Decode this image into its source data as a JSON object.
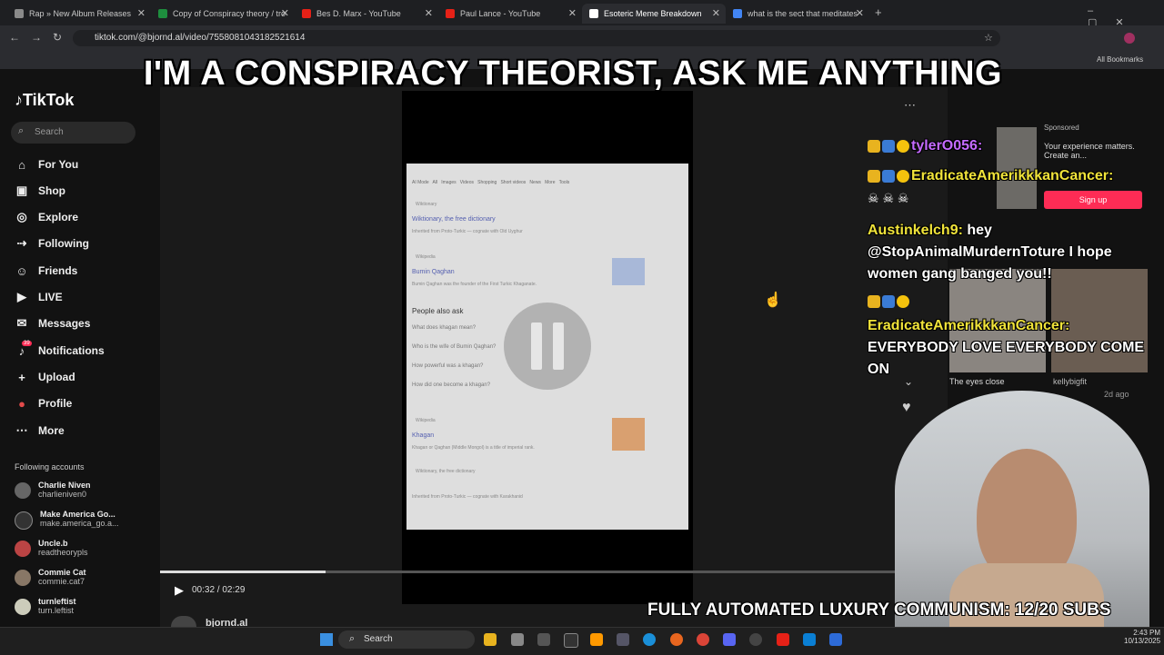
{
  "browser": {
    "tabs": [
      {
        "label": "Rap » New Album Releases",
        "color": "#8a8a8a"
      },
      {
        "label": "Copy of Conspiracy theory / tro",
        "color": "#1e8e3e"
      },
      {
        "label": "Bes D. Marx - YouTube",
        "color": "#e62117"
      },
      {
        "label": "Paul Lance - YouTube",
        "color": "#e62117"
      },
      {
        "label": "Esoteric Meme Breakdown",
        "color": "#ffffff"
      },
      {
        "label": "what is the sect that meditates",
        "color": "#4285f4"
      }
    ],
    "url": "tiktok.com/@bjornd.al/video/7558081043182521614",
    "all_bookmarks": "All Bookmarks"
  },
  "tiktok": {
    "logo": "TikTok",
    "search_placeholder": "Search",
    "nav": [
      {
        "label": "For You",
        "icon": "home-icon",
        "glyph": "⌂"
      },
      {
        "label": "Shop",
        "icon": "shop-icon",
        "glyph": "▣"
      },
      {
        "label": "Explore",
        "icon": "compass-icon",
        "glyph": "◎"
      },
      {
        "label": "Following",
        "icon": "following-icon",
        "glyph": "⇢"
      },
      {
        "label": "Friends",
        "icon": "friends-icon",
        "glyph": "☺"
      },
      {
        "label": "LIVE",
        "icon": "live-icon",
        "glyph": "▶"
      },
      {
        "label": "Messages",
        "icon": "messages-icon",
        "glyph": "✉"
      },
      {
        "label": "Notifications",
        "icon": "bell-icon",
        "glyph": "♪"
      },
      {
        "label": "Upload",
        "icon": "upload-icon",
        "glyph": "+"
      },
      {
        "label": "Profile",
        "icon": "profile-icon",
        "glyph": "●"
      },
      {
        "label": "More",
        "icon": "more-icon",
        "glyph": "⋯"
      }
    ],
    "notifications_badge": "39",
    "following_header": "Following accounts",
    "accounts": [
      {
        "name": "Charlie Niven",
        "handle": "charlieniven0"
      },
      {
        "name": "Make America Go...",
        "handle": "make.america_go.a..."
      },
      {
        "name": "Uncle.b",
        "handle": "readtheorypls"
      },
      {
        "name": "Commie Cat",
        "handle": "commie.cat7"
      },
      {
        "name": "turnleftist",
        "handle": "turn.leftist"
      }
    ],
    "video_time": "00:32 / 02:29",
    "video_progress": 0.21,
    "username_partial": "bjornd.al"
  },
  "search_screenshot": {
    "results": [
      {
        "title": "Wiktionary, the free dictionary"
      },
      {
        "title": "Bumin Qaghan"
      },
      {
        "title": "Khagan"
      }
    ],
    "people_also_ask": "People also ask",
    "questions": [
      "What does khagan mean?",
      "Who is the wife of Bumin Qaghan?",
      "How powerful was a khagan?",
      "How did one become a khagan?"
    ]
  },
  "overlay": {
    "title": "I'M A CONSPIRACY THEORIST, ASK ME ANYTHING",
    "chat": [
      {
        "user": "tylerO056:",
        "text": ""
      },
      {
        "user": "EradicateAmerikkkanCancer:",
        "text": ""
      },
      {
        "user": "Austinkelch9:",
        "text": "hey @StopAnimalMurdernToture I hope women gang banged you!!"
      },
      {
        "user": "EradicateAmerikkkanCancer:",
        "text": "EVERYBODY LOVE EVERYBODY COME ON"
      }
    ],
    "subs": "FULLY AUTOMATED LUXURY COMMUNISM: 12/20 SUBS"
  },
  "right_panel": {
    "sponsored": "Sponsored",
    "ad_text": "Your experience matters. Create an...",
    "signup": "Sign up",
    "caption_1": "The eyes close",
    "caption_2": "kellybigfit",
    "date": "2d ago"
  },
  "taskbar": {
    "search": "Search",
    "time": "2:43 PM",
    "date": "10/13/2025"
  }
}
